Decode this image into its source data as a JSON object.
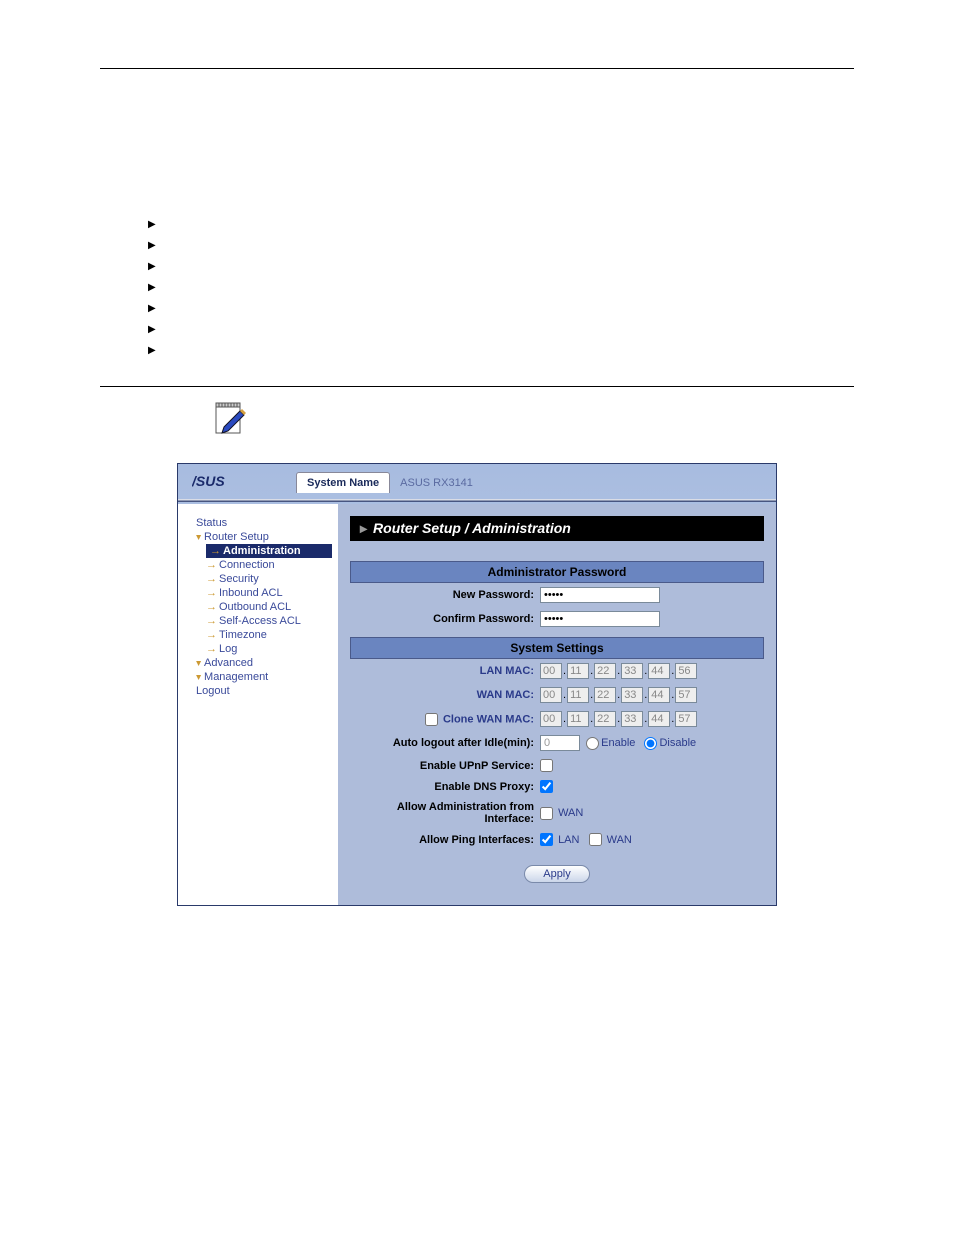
{
  "header": {
    "system_name_label": "System Name",
    "system_name_value": "ASUS RX3141"
  },
  "sidebar": {
    "items": [
      {
        "label": "Status",
        "type": "link"
      },
      {
        "label": "Router Setup",
        "type": "expand"
      },
      {
        "label": "Administration",
        "type": "sub",
        "selected": true
      },
      {
        "label": "Connection",
        "type": "sub"
      },
      {
        "label": "Security",
        "type": "sub"
      },
      {
        "label": "Inbound ACL",
        "type": "sub"
      },
      {
        "label": "Outbound ACL",
        "type": "sub"
      },
      {
        "label": "Self-Access ACL",
        "type": "sub"
      },
      {
        "label": "Timezone",
        "type": "sub"
      },
      {
        "label": "Log",
        "type": "sub"
      },
      {
        "label": "Advanced",
        "type": "expand"
      },
      {
        "label": "Management",
        "type": "expand"
      },
      {
        "label": "Logout",
        "type": "link"
      }
    ]
  },
  "content": {
    "breadcrumb": "Router Setup / Administration",
    "sections": {
      "password": {
        "heading": "Administrator Password",
        "new_password_label": "New Password:",
        "new_password_value": "•••••",
        "confirm_password_label": "Confirm Password:",
        "confirm_password_value": "•••••"
      },
      "system": {
        "heading": "System Settings",
        "lan_mac_label": "LAN MAC:",
        "lan_mac": [
          "00",
          "11",
          "22",
          "33",
          "44",
          "56"
        ],
        "wan_mac_label": "WAN MAC:",
        "wan_mac": [
          "00",
          "11",
          "22",
          "33",
          "44",
          "57"
        ],
        "clone_mac_label": "Clone WAN MAC:",
        "clone_mac_checked": false,
        "clone_mac": [
          "00",
          "11",
          "22",
          "33",
          "44",
          "57"
        ],
        "idle_label": "Auto logout after Idle(min):",
        "idle_value": "0",
        "idle_enable_label": "Enable",
        "idle_disable_label": "Disable",
        "idle_selected": "disable",
        "upnp_label": "Enable UPnP Service:",
        "upnp_checked": false,
        "dns_label": "Enable DNS Proxy:",
        "dns_checked": true,
        "admin_if_label": "Allow Administration from Interface:",
        "admin_wan_label": "WAN",
        "admin_wan_checked": false,
        "ping_label": "Allow Ping Interfaces:",
        "ping_lan_label": "LAN",
        "ping_lan_checked": true,
        "ping_wan_label": "WAN",
        "ping_wan_checked": false,
        "apply_label": "Apply"
      }
    }
  },
  "doc": {
    "page_number": ""
  }
}
